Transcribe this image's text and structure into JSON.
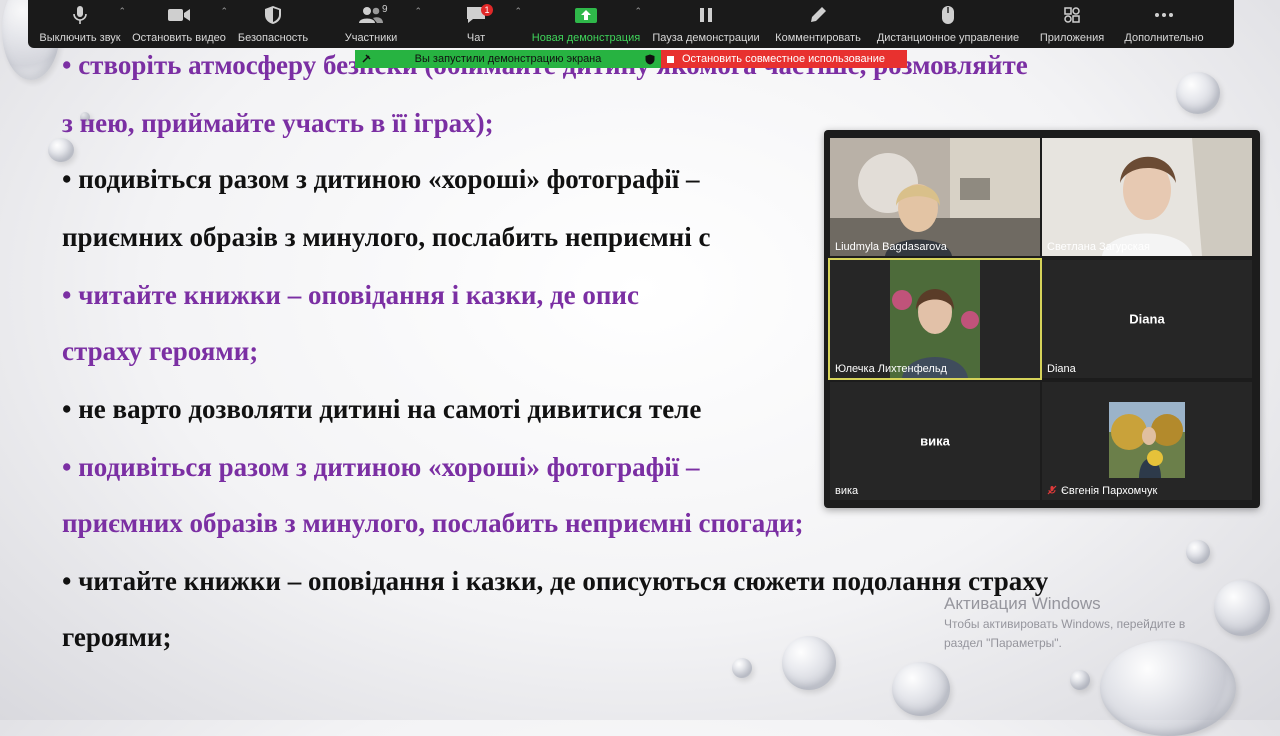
{
  "toolbar": {
    "items": [
      {
        "label": "Выключить звук",
        "icon": "microphone-icon"
      },
      {
        "label": "Остановить видео",
        "icon": "video-camera-icon"
      },
      {
        "label": "Безопасность",
        "icon": "shield-icon"
      },
      {
        "label": "Участники",
        "icon": "participants-icon",
        "count": "9"
      },
      {
        "label": "Чат",
        "icon": "chat-icon",
        "badge": "1"
      },
      {
        "label": "Новая демонстрация",
        "icon": "share-screen-icon"
      },
      {
        "label": "Пауза демонстрации",
        "icon": "pause-icon"
      },
      {
        "label": "Комментировать",
        "icon": "pencil-icon"
      },
      {
        "label": "Дистанционное управление",
        "icon": "mouse-icon"
      },
      {
        "label": "Приложения",
        "icon": "apps-icon"
      },
      {
        "label": "Дополнительно",
        "icon": "more-icon"
      }
    ]
  },
  "banner": {
    "sharing": "Вы запустили демонстрацию экрана",
    "stop": "Остановить совместное использование"
  },
  "slide": {
    "lines": [
      "•  створіть атмосферу безпеки (обіймайте дитину якомога частіше, розмовляйте",
      "з нею, приймайте участь в її іграх);",
      "•  подивіться разом з дитиною «хороші» фотографії –",
      "приємних образів з минулого, послабить неприємні с",
      "•   читайте книжки – оповідання і казки, де опис",
      "страху героями;",
      "•  не варто дозволяти дитині на самоті дивитися теле",
      "•  подивіться разом з дитиною «хороші» фотографії –",
      "приємних образів з минулого, послабить неприємні спогади;",
      "• читайте книжки – оповідання і казки, де описуються сюжети подолання страху",
      "героями;"
    ]
  },
  "participants": [
    {
      "name": "Liudmyla Bagdasarova",
      "has_video": true
    },
    {
      "name": "Светлана Загурская",
      "has_video": true
    },
    {
      "name": "Юлечка Лихтенфельд",
      "has_video": true,
      "active": true
    },
    {
      "name": "Diana",
      "center_label": "Diana",
      "has_video": false
    },
    {
      "name": "вика",
      "center_label": "вика",
      "has_video": false
    },
    {
      "name": "Євгенія Пархомчук",
      "has_video": true,
      "muted": true
    }
  ],
  "watermark": {
    "title": "Активация Windows",
    "line1": "Чтобы активировать Windows, перейдите в",
    "line2": "раздел \"Параметры\"."
  },
  "colors": {
    "purple_text": "#7b2fa3",
    "toolbar_bg": "#1a1a1a",
    "share_green": "#27b341",
    "stop_red": "#e8312f",
    "active_speaker": "#d6d35a"
  }
}
